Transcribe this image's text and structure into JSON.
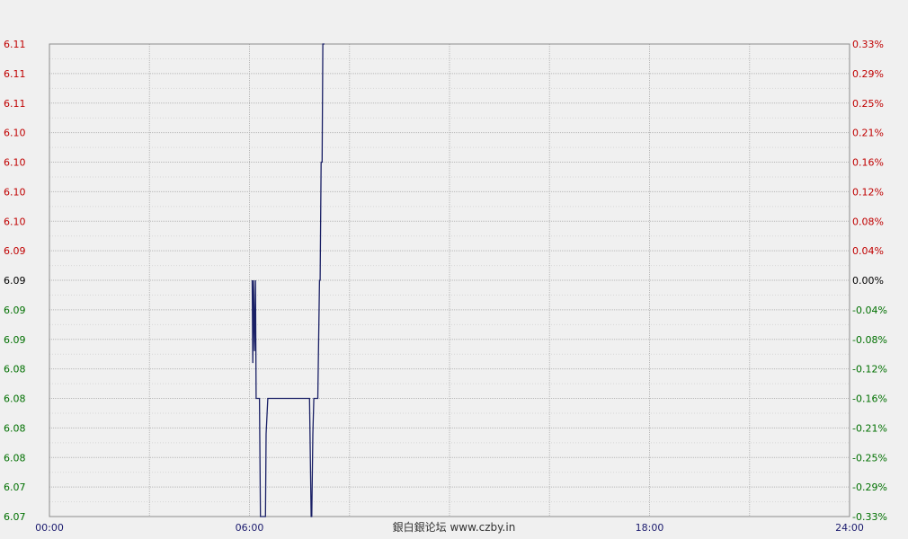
{
  "chart_data": {
    "type": "line",
    "title": "",
    "xlabel": "",
    "ylabel": "",
    "x_ticks": [
      "00:00",
      "06:00",
      "18:00",
      "24:00"
    ],
    "x_range_hours": [
      0,
      24
    ],
    "x_grid_every_hours": 3,
    "y_range": [
      6.07,
      6.11
    ],
    "reference_value": 6.09,
    "left_ticks": [
      "6.11",
      "6.11",
      "6.11",
      "6.10",
      "6.10",
      "6.10",
      "6.10",
      "6.09",
      "6.09",
      "6.09",
      "6.09",
      "6.08",
      "6.08",
      "6.08",
      "6.08",
      "6.07",
      "6.07"
    ],
    "right_ticks": [
      "0.33%",
      "0.29%",
      "0.25%",
      "0.21%",
      "0.16%",
      "0.12%",
      "0.08%",
      "0.04%",
      "0.00%",
      "-0.04%",
      "-0.08%",
      "-0.12%",
      "-0.16%",
      "-0.21%",
      "-0.25%",
      "-0.29%",
      "-0.33%"
    ],
    "grid": true,
    "series": [
      {
        "x_hours": [
          6.08,
          6.1,
          6.12,
          6.15,
          6.18,
          6.2,
          6.22,
          6.25,
          6.3,
          6.33,
          6.38,
          6.42,
          6.48,
          6.5,
          6.55,
          6.6,
          6.65,
          6.7,
          6.8,
          7.0,
          7.4,
          7.8,
          7.85,
          7.87,
          7.9,
          7.93,
          7.95,
          8.0,
          8.05,
          8.1,
          8.12,
          8.15,
          8.18,
          8.2,
          8.22,
          8.25
        ],
        "values": [
          6.09,
          6.083,
          6.09,
          6.084,
          6.09,
          6.08,
          6.08,
          6.08,
          6.08,
          6.07,
          6.07,
          6.07,
          6.07,
          6.077,
          6.08,
          6.08,
          6.08,
          6.08,
          6.08,
          6.08,
          6.08,
          6.08,
          6.07,
          6.07,
          6.077,
          6.08,
          6.08,
          6.08,
          6.08,
          6.09,
          6.09,
          6.1,
          6.1,
          6.11,
          6.11,
          6.11
        ]
      }
    ],
    "colors": {
      "line": "#1a2066",
      "up": "#c00000",
      "down": "#007000",
      "flat": "#000000",
      "grid": "#b8b8b8",
      "axis": "#8c8c8c",
      "x_tick": "#1a1a6e"
    }
  },
  "watermark": "銀白銀论坛 www.czby.in"
}
